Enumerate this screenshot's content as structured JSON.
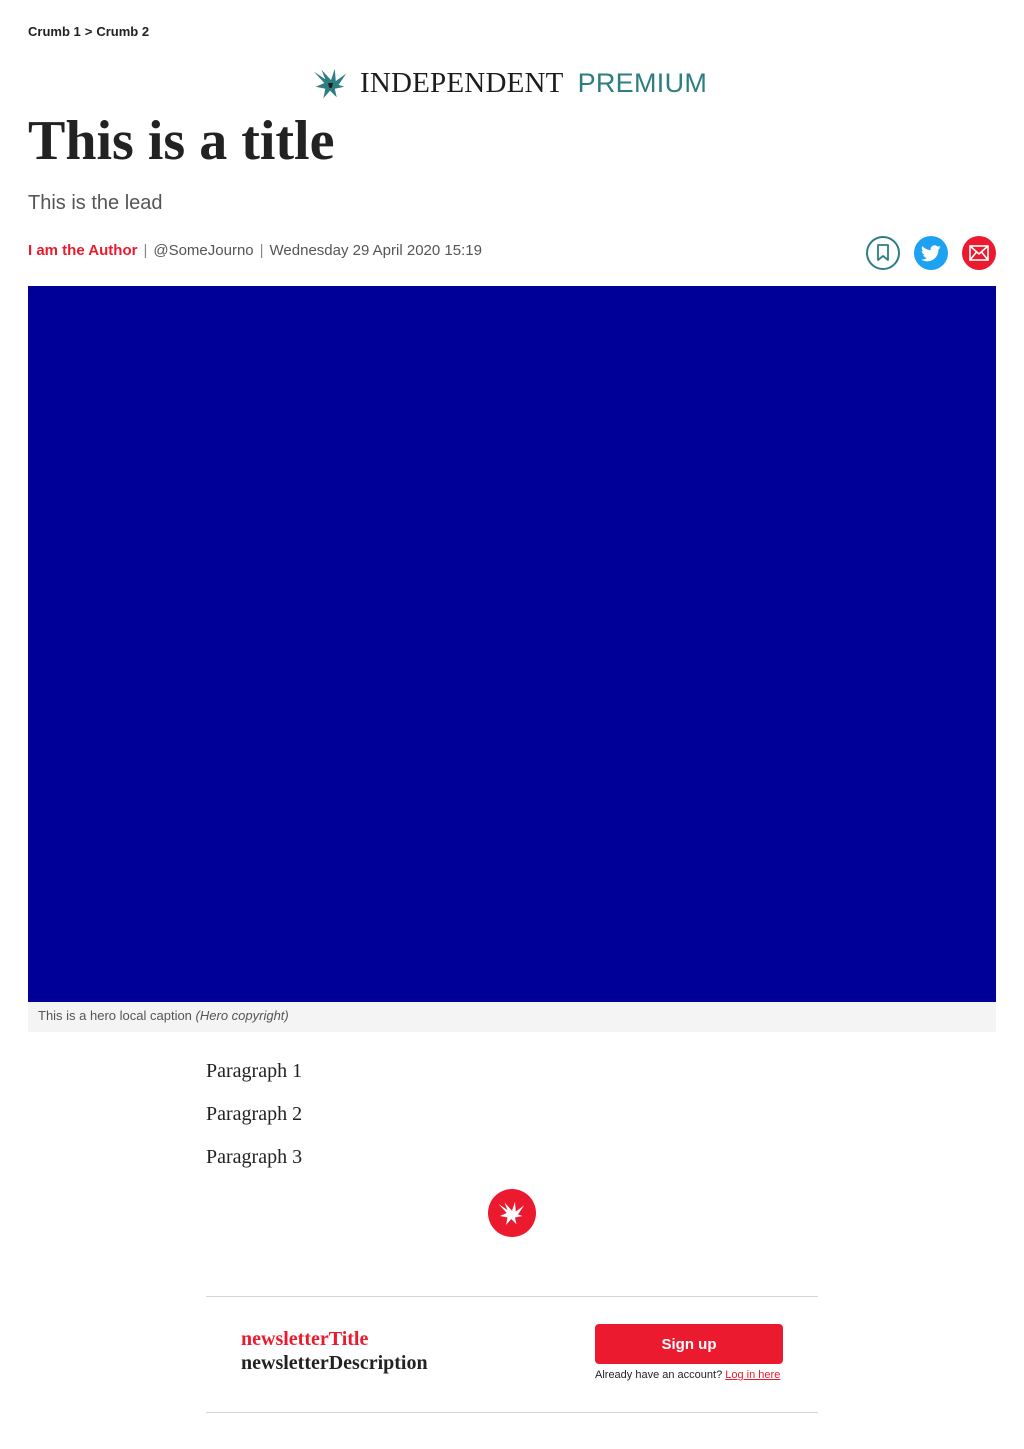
{
  "breadcrumb": {
    "items": [
      "Crumb 1",
      "Crumb 2"
    ],
    "separator": ">"
  },
  "masthead": {
    "brand": "INDEPENDENT",
    "premium": "PREMIUM",
    "icon": "eagle-logo-icon",
    "colors": {
      "brand": "#1d1d1b",
      "premium": "#2e7d80"
    }
  },
  "article": {
    "title": "This is a title",
    "lead": "This is the lead",
    "author": "I am the Author",
    "twitter_handle": "@SomeJourno",
    "date": "Wednesday 29 April 2020 15:19",
    "separator": "|"
  },
  "share": {
    "icons": [
      "bookmark-icon",
      "twitter-icon",
      "email-icon"
    ],
    "colors": {
      "bookmark": "#2e7d80",
      "twitter": "#1da1f2",
      "email": "#ec1a2e"
    }
  },
  "hero": {
    "color": "#000099",
    "caption": "This is a hero local caption",
    "copyright": "(Hero copyright)"
  },
  "body": {
    "paragraphs": [
      "Paragraph 1",
      "Paragraph 2",
      "Paragraph 3"
    ]
  },
  "newsletter": {
    "title": "newsletterTitle",
    "description": "newsletterDescription",
    "signup_label": "Sign up",
    "login_prompt": "Already have an account?",
    "login_link": "Log in here"
  },
  "colors": {
    "accent": "#ec1a2e",
    "text": "#222222",
    "muted": "#555555"
  }
}
